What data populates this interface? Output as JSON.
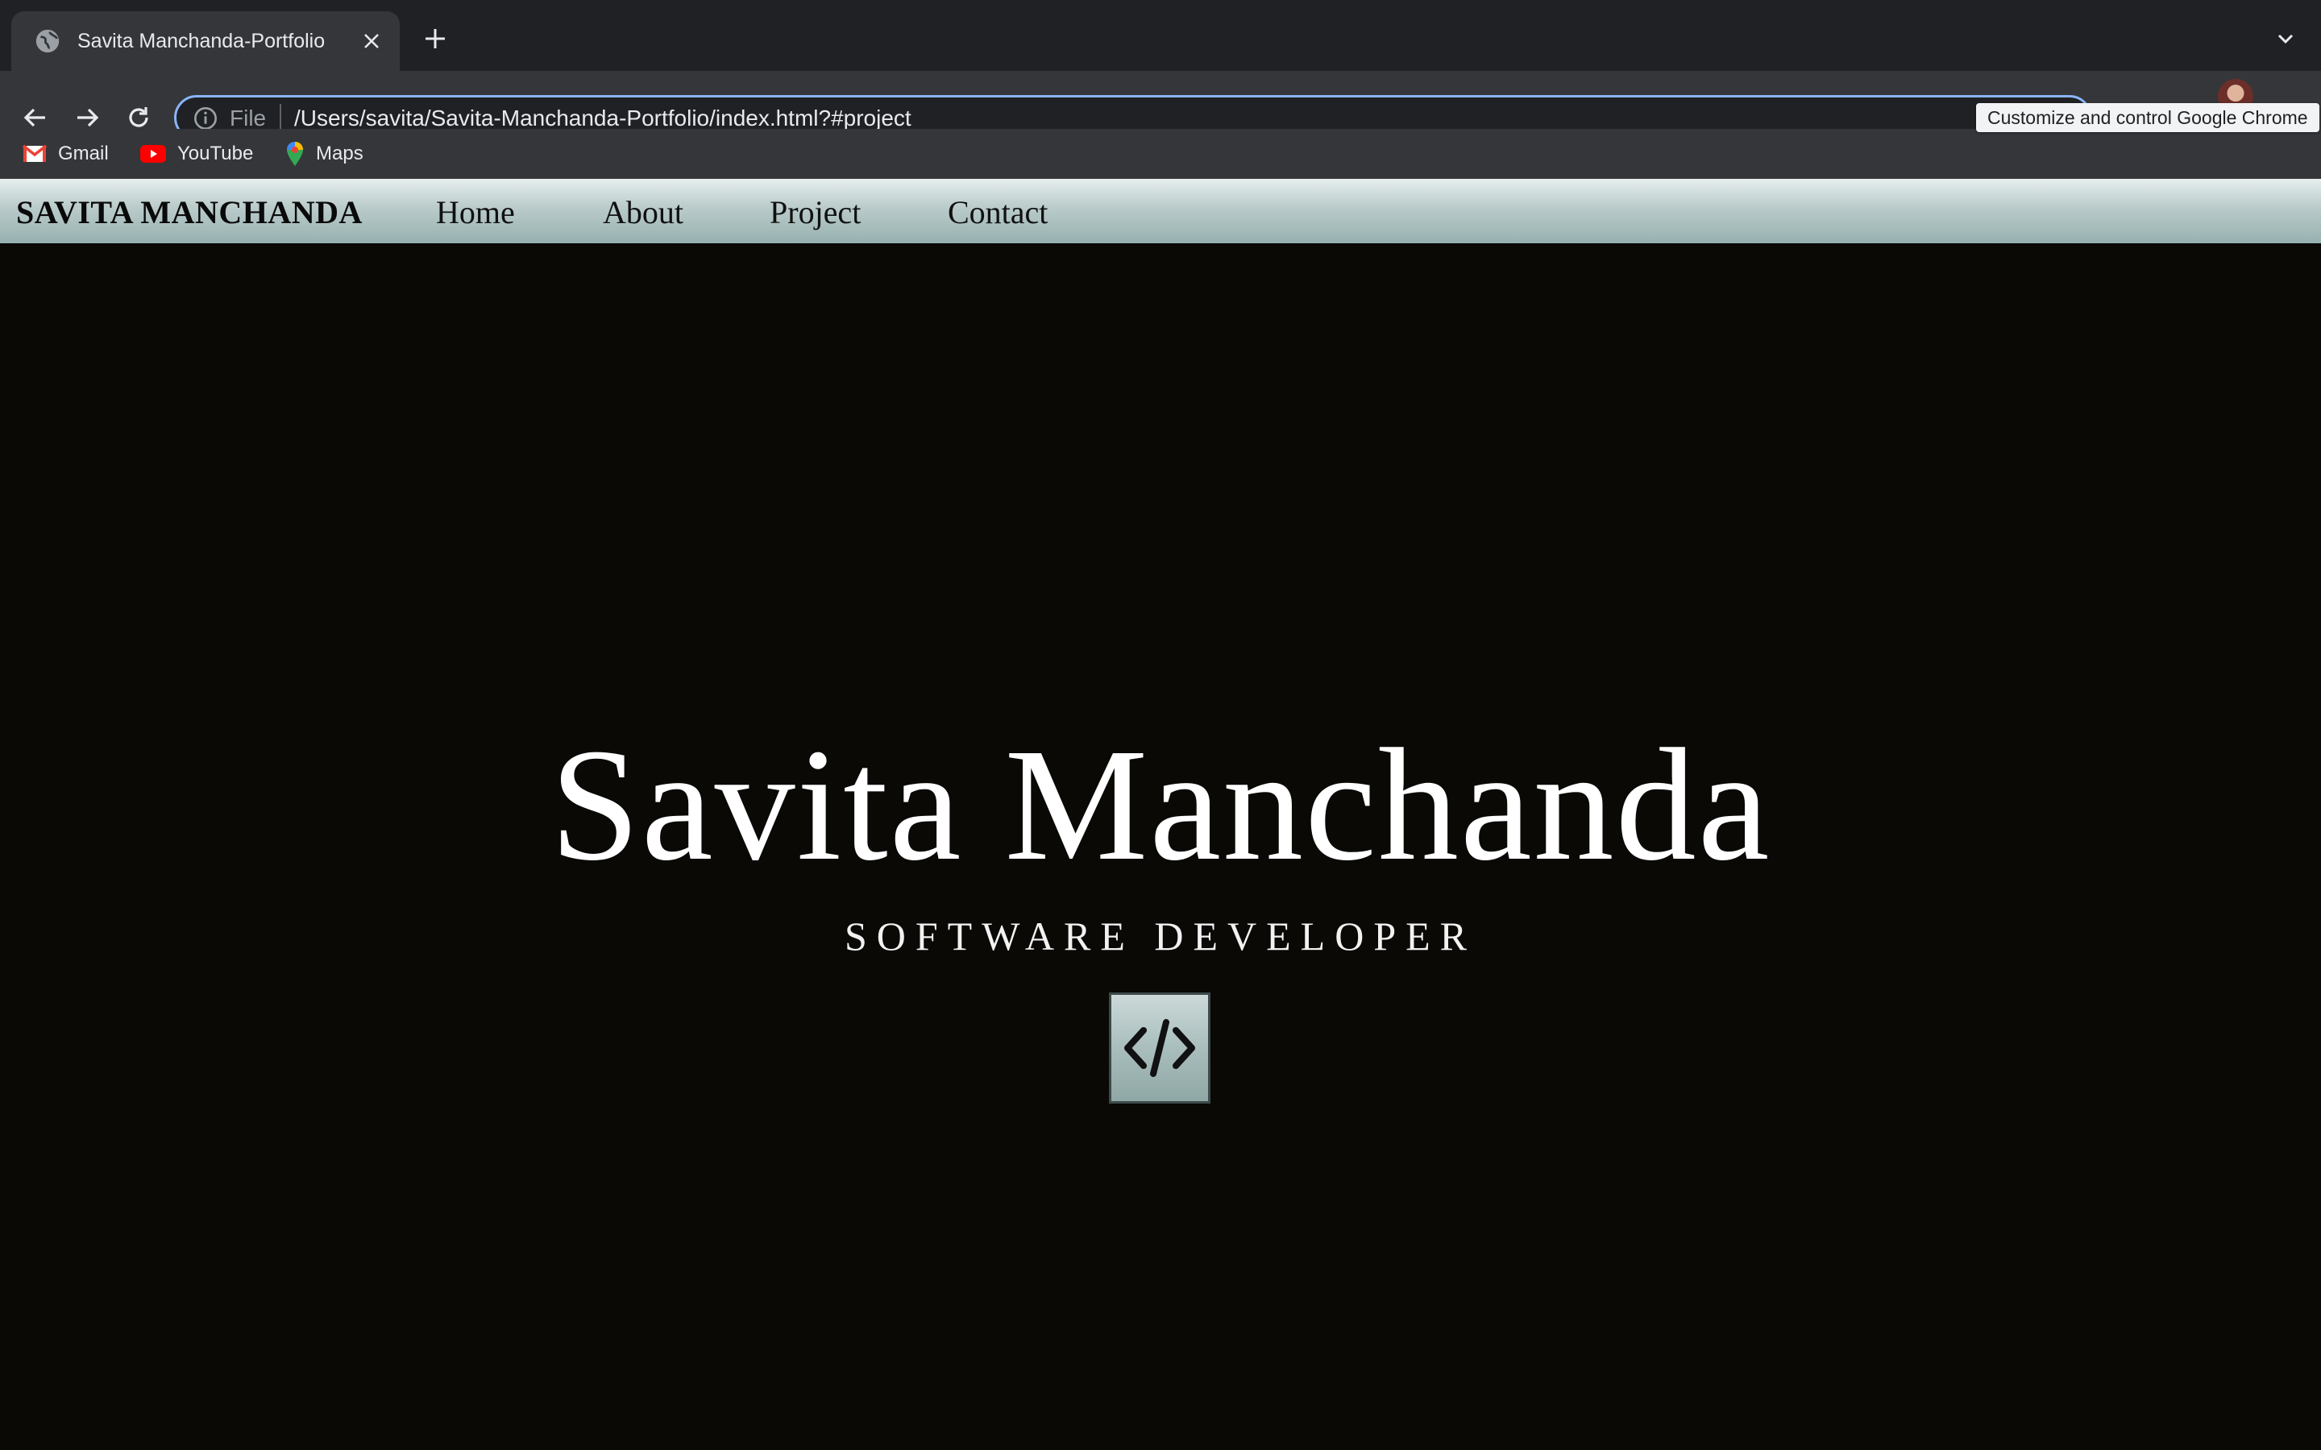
{
  "browser": {
    "tab_title": "Savita Manchanda-Portfolio",
    "omnibox": {
      "scheme_label": "File",
      "url": "/Users/savita/Savita-Manchanda-Portfolio/index.html?#project"
    },
    "tooltip": "Customize and control Google Chrome",
    "bookmarks": [
      {
        "label": "Gmail",
        "icon": "gmail-icon"
      },
      {
        "label": "YouTube",
        "icon": "youtube-icon"
      },
      {
        "label": "Maps",
        "icon": "maps-icon"
      }
    ]
  },
  "site": {
    "brand": "SAVITA MANCHANDA",
    "nav": [
      {
        "label": "Home"
      },
      {
        "label": "About"
      },
      {
        "label": "Project"
      },
      {
        "label": "Contact"
      }
    ],
    "hero": {
      "name": "Savita Manchanda",
      "subtitle": "SOFTWARE DEVELOPER",
      "icon": "code-icon"
    }
  },
  "colors": {
    "page_bg": "#0a0906",
    "nav_gradient_top": "#e6efee",
    "nav_gradient_bottom": "#97b1b0",
    "omnibox_focus": "#8ab4f8"
  }
}
